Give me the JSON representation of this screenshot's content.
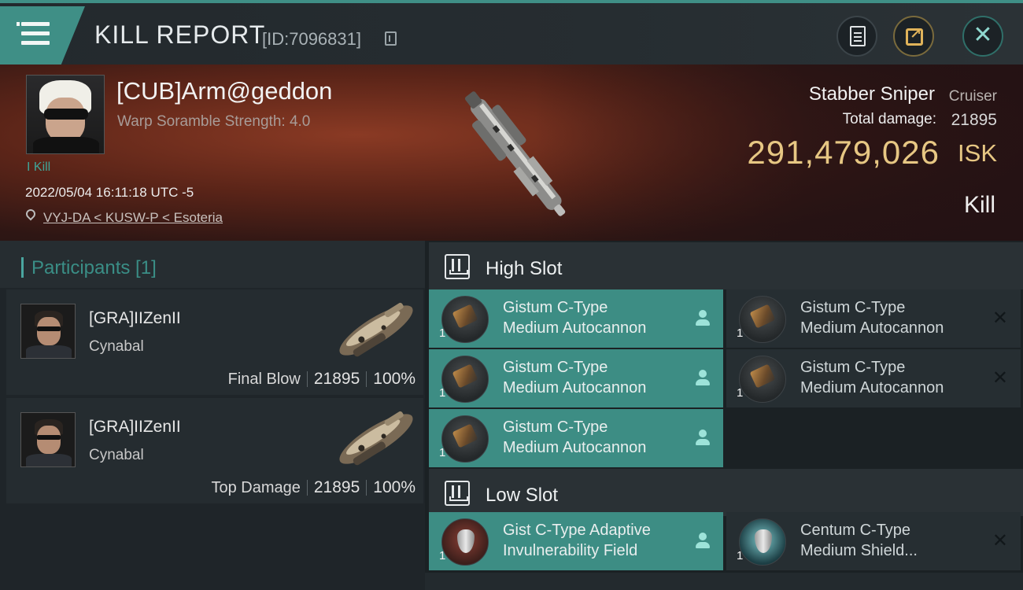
{
  "header": {
    "title": "KILL REPORT",
    "report_id": "[ID:7096831]"
  },
  "victim": {
    "pilot_name": "[CUB]Arm@geddon",
    "warp_scramble": "Warp Soramble Strength: 4.0",
    "kill_tag": "I Kill",
    "datetime": "2022/05/04 16:11:18 UTC -5",
    "location": "VYJ-DA < KUSW-P < Esoteria",
    "ship_name": "Stabber Sniper",
    "ship_class": "Cruiser",
    "total_damage_label": "Total damage:",
    "total_damage": "21895",
    "isk_value": "291,479,026",
    "isk_unit": "ISK",
    "result": "Kill"
  },
  "participants": {
    "title": "Participants [1]",
    "rows": [
      {
        "name": "[GRA]IIZenII",
        "ship": "Cynabal",
        "role": "Final Blow",
        "damage": "21895",
        "percent": "100%"
      },
      {
        "name": "[GRA]IIZenII",
        "ship": "Cynabal",
        "role": "Top Damage",
        "damage": "21895",
        "percent": "100%"
      }
    ]
  },
  "fitting": {
    "high_slot": {
      "title": "High Slot",
      "modules": [
        {
          "line1": "Gistum C-Type",
          "line2": "Medium Autocannon",
          "qty": "1",
          "status": "dropped"
        },
        {
          "line1": "Gistum C-Type",
          "line2": "Medium Autocannon",
          "qty": "1",
          "status": "destroyed"
        },
        {
          "line1": "Gistum C-Type",
          "line2": "Medium Autocannon",
          "qty": "1",
          "status": "dropped"
        },
        {
          "line1": "Gistum C-Type",
          "line2": "Medium Autocannon",
          "qty": "1",
          "status": "destroyed"
        },
        {
          "line1": "Gistum C-Type",
          "line2": "Medium Autocannon",
          "qty": "1",
          "status": "dropped"
        }
      ]
    },
    "low_slot": {
      "title": "Low Slot",
      "modules": [
        {
          "line1": "Gist C-Type Adaptive",
          "line2": "Invulnerability Field",
          "qty": "1",
          "status": "dropped"
        },
        {
          "line1": "Centum C-Type",
          "line2": "Medium Shield...",
          "qty": "1",
          "status": "destroyed"
        }
      ]
    }
  },
  "icons": {
    "menu": "hamburger-menu-icon",
    "copy": "copy-icon",
    "clipboard": "clipboard-icon",
    "share": "share-icon",
    "close": "close-icon",
    "location": "location-pin-icon",
    "slot": "slot-rack-icon",
    "dropped": "person-icon",
    "destroyed": "x-icon"
  },
  "colors": {
    "accent_teal": "#3f8f86",
    "isk_gold": "#e7c783",
    "banner_red": "#5a2418"
  }
}
